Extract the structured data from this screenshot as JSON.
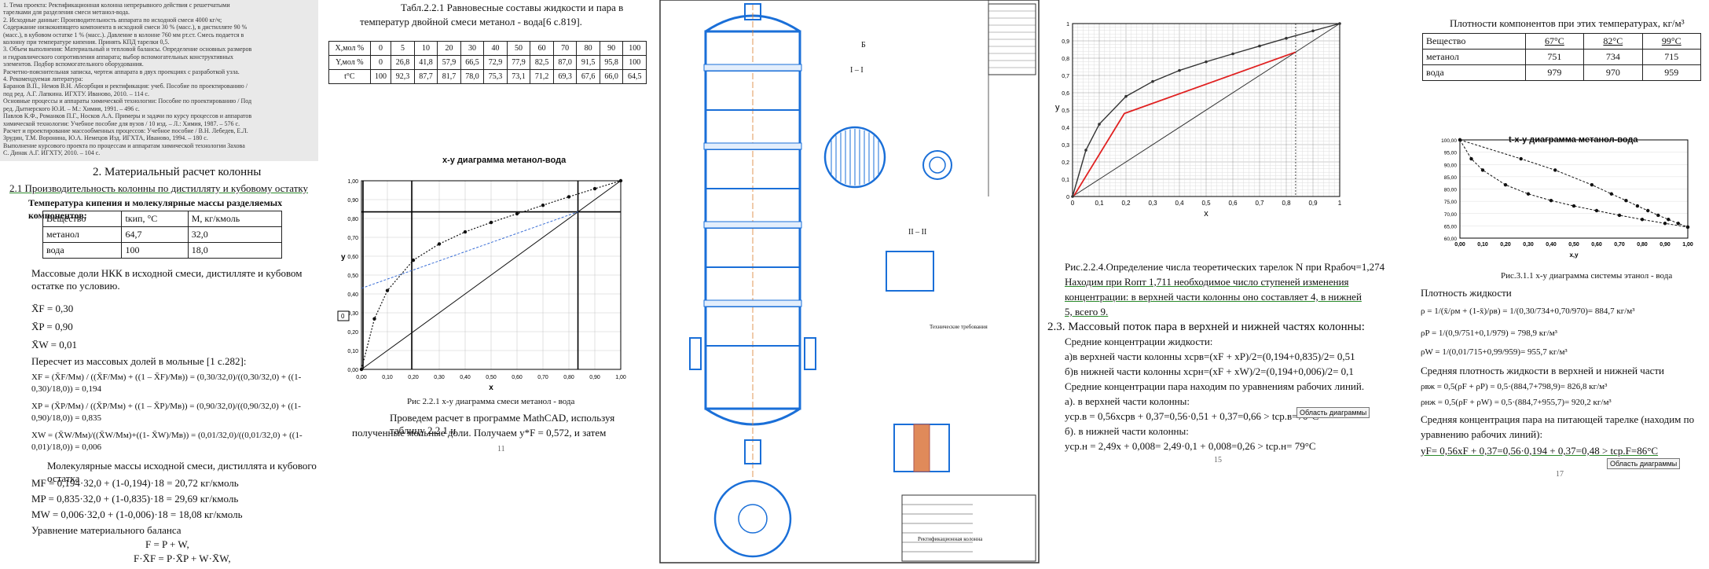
{
  "panel1": {
    "top_lines": [
      "1. Тема проекта: Ректификационная колонна непрерывного действия с решетчатыми",
      "тарелками для разделения смеси метанол-вода.",
      "2. Исходные данные: Производительность аппарата по исходной смеси 4000 кг/ч;",
      "Содержание низкокипящего компонента в исходной смеси 30 % (масс.), в дистилляте 90 %",
      "(масс.), в кубовом остатке 1 % (масс.). Давление в колонне 760 мм рт.ст. Смесь подается в",
      "колонну при температуре кипения. Принять КПД тарелки 0,5.",
      "3. Объем выполнения: Материальный и тепловой балансы. Определение основных размеров",
      "и гидравлического сопротивления аппарата; выбор вспомогательных конструктивных",
      "элементов. Подбор вспомогательного оборудования.",
      "Расчетно-пояснительная записка, чертеж аппарата в двух проекциях с разработкой узла.",
      "4. Рекомендуемая литература:",
      "Баранов В.П., Немов В.Н. Абсорбция и ректификация: учеб. Пособие по проектированию /",
      "под ред. А.Г. Лапкина. ИГХТУ. Иваново, 2010. – 114 с.",
      "Основные процессы и аппараты химической технологии: Пособие по проектированию / Под",
      "ред. Дытнерского Ю.И. – М.: Химия, 1991. – 496 с.",
      "Павлов К.Ф., Романков П.Г., Носков А.А. Примеры и задачи по курсу процессов и аппаратов",
      "химической технологии: Учебное пособие для вузов / 10 изд. – Л.: Химия, 1987. – 576 с.",
      "Расчет и проектирование массообменных процессов: Учебное пособие / В.Н. Лебедев, Е.Л.",
      "Зрудин, Т.М. Воронина, Ю.А. Немецов Изд. ИГХТА, Иваново, 1994. – 180 с.",
      "Выполнение курсового проекта по процессам и аппаратам химической технологии Захова",
      "С. Динак А.Г. ИГХТУ, 2010. – 104 с."
    ],
    "section_title": "2. Материальный расчет колонны",
    "subsection": "2.1 Производительность колонны по дистилляту и кубовому остатку",
    "table_caption": "Температура кипения и молекулярные массы разделяемых компонентов:",
    "table_head": [
      "Вещество",
      "tкип, °С",
      "M, кг/кмоль"
    ],
    "table_rows": [
      [
        "метанол",
        "64,7",
        "32,0"
      ],
      [
        "вода",
        "100",
        "18,0"
      ]
    ],
    "text1": "Массовые доли НКК в исходной смеси, дистилляте и кубовом остатке по условию.",
    "xf": "X̄F = 0,30",
    "xp": "X̄P = 0,90",
    "xw": "X̄W = 0,01",
    "recalc": "Пересчет из массовых долей в мольные [1 с.282]:",
    "f1a": "XF = (X̄F/Mм) / ((X̄F/Mм) + ((1 – X̄F)/Mв)) = (0,30/32,0)/((0,30/32,0) + ((1-",
    "f1b": "0,30)/18,0)) = 0,194",
    "f2a": "XP = (X̄P/Mм) / ((X̄P/Mм) + ((1 – X̄P)/Mв)) = (0,90/32,0)/((0,90/32,0) + ((1-",
    "f2b": "0,90)/18,0)) = 0,835",
    "f3a": "XW = (X̄W/Mм)/((X̄W/Mм)+((1- X̄W)/Mв)) = (0,01/32,0)/((0,01/32,0) + ((1-",
    "f3b": "0,01)/18,0)) = 0,006",
    "mol_title": "Молекулярные массы исходной смеси, дистиллята и кубового остатка",
    "mf": "MF = 0,194·32,0 + (1-0,194)·18 = 20,72 кг/кмоль",
    "mp": "MP = 0,835·32,0 + (1-0,835)·18 = 29,69 кг/кмоль",
    "mw": "MW = 0,006·32,0 + (1-0,006)·18 = 18,08 кг/кмоль",
    "balance_title": "Уравнение материального баланса",
    "eq1": "F = P + W,",
    "eq2": "F·X̄F = P·X̄P + W·X̄W,"
  },
  "panel2": {
    "table_title": "Табл.2.2.1 Равновесные составы жидкости и пара в",
    "table_title2": "температур двойной смеси метанол - вода[6 с.819].",
    "row_x": [
      "X,мол %",
      "0",
      "5",
      "10",
      "20",
      "30",
      "40",
      "50",
      "60",
      "70",
      "80",
      "90",
      "100"
    ],
    "row_y": [
      "Y,мол %",
      "0",
      "26,8",
      "41,8",
      "57,9",
      "66,5",
      "72,9",
      "77,9",
      "82,5",
      "87,0",
      "91,5",
      "95,8",
      "100"
    ],
    "row_t": [
      "t°C",
      "100",
      "92,3",
      "87,7",
      "81,7",
      "78,0",
      "75,3",
      "73,1",
      "71,2",
      "69,3",
      "67,6",
      "66,0",
      "64,5"
    ],
    "chart_title": "x-y диаграмма метанол-вода",
    "xlabel": "x",
    "ylabel": "y",
    "tick_x": [
      "0,00",
      "0,10",
      "0,20",
      "0,30",
      "0,40",
      "0,50",
      "0,60",
      "0,70",
      "0,80",
      "0,90",
      "1,00"
    ],
    "tick_y": [
      "0,00",
      "0,10",
      "0,20",
      "0,30",
      "0,40",
      "0,50",
      "0,60",
      "0,70",
      "0,80",
      "0,90",
      "1,00"
    ],
    "box_label": "0",
    "caption": "Рис 2.2.1 x-y диаграмма смеси метанол - вода",
    "text_a": "Проведем расчет в программе MathCAD, используя таблицу 2.2.1 и",
    "text_b": "полученные мольные доли. Получаем y*F = 0,572, и затем",
    "page_no": "11"
  },
  "panel3": {
    "section_labels": [
      "Б",
      "I – I",
      "II – II"
    ],
    "note_title": "Технические требования",
    "stamp_label": "Ректификационная колонна"
  },
  "panel4": {
    "y_label": "y",
    "x_label": "x",
    "tick_x": [
      "0",
      "0,1",
      "0,2",
      "0,3",
      "0,4",
      "0,5",
      "0,6",
      "0,7",
      "0,8",
      "0,9",
      "1"
    ],
    "tick_y": [
      "0",
      "0,1",
      "0,2",
      "0,3",
      "0,4",
      "0,5",
      "0,6",
      "0,7",
      "0,8",
      "0,9",
      "1"
    ],
    "fig_caption_a": "Рис.2.2.4.Определение числа теоретических тарелок N при Rрабоч=1,274",
    "fig_caption_b": "Находим при Rопт 1,711 необходимое число ступеней изменения",
    "fig_caption_c": "концентрации: в верхней части колонны оно составляет 4, в нижней",
    "fig_caption_d": "5, всего 9.",
    "sec_title": "2.3. Массовый поток пара в верхней и нижней частях колонны:",
    "avg_liquid": "Средние концентрации жидкости:",
    "a_top": "а)в верхней части колонны xсрв=(xF + xP)/2=(0,194+0,835)/2= 0,51",
    "b_bottom": "б)в нижней части колонны xсрн=(xF + xW)/2=(0,194+0,006)/2= 0,1",
    "avg_vapor": "Средние концентрации пара находим по уравнениям рабочих линий.",
    "a_vapor": "а). в верхней части колонны:",
    "eq_top": "yср.в = 0,56xсрв + 0,37=0,56·0,51 + 0,37=0,66 > tср.в=70°С",
    "b_vapor": "б). в нижней части колонны:",
    "eq_bot": "yср.н = 2,49x + 0,008= 2,49·0,1 + 0,008=0,26 > tср.н= 79°С",
    "tooltip": "Область диаграммы",
    "page_no": "15"
  },
  "panel5": {
    "density_title": "Плотности компонентов при этих температурах, кг/м³",
    "table_head": [
      "Вещество",
      "67°С",
      "82°С",
      "99°С"
    ],
    "table_rows": [
      [
        "метанол",
        "751",
        "734",
        "715"
      ],
      [
        "вода",
        "979",
        "970",
        "959"
      ]
    ],
    "chart_title": "t-x-y диаграмма метанол-вода",
    "tick_y": [
      "100,00",
      "95,00",
      "90,00",
      "85,00",
      "80,00",
      "75,00",
      "70,00",
      "65,00",
      "60,00"
    ],
    "tick_x": [
      "0,00",
      "0,10",
      "0,20",
      "0,30",
      "0,40",
      "0,50",
      "0,60",
      "0,70",
      "0,80",
      "0,90",
      "1,00"
    ],
    "xlabel": "x,y",
    "caption": "Рис.3.1.1 x-y диаграмма системы этанол - вода",
    "density_label": "Плотность жидкости",
    "rho1": "ρ = 1/(x̄/ρм + (1-x̄)/ρв) = 1/(0,30/734+0,70/970)= 884,7 кг/м³",
    "rho2": "ρP = 1/(0,9/751+0,1/979) = 798,9 кг/м³",
    "rho3": "ρW = 1/(0,01/715+0,99/959)= 955,7 кг/м³",
    "avg_density_title": "Средняя плотность жидкости в верхней и нижней части",
    "rho_top": "ρвж = 0,5(ρF + ρP) = 0,5·(884,7+798,9)= 826,8 кг/м³",
    "rho_bot": "ρнж = 0,5(ρF + ρW) = 0,5·(884,7+955,7)= 920,2 кг/м³",
    "feed_a": "Средняя концентрация пара на питающей тарелке (находим по",
    "feed_b": "уравнению рабочих линий):",
    "feed_eq": "yF= 0,56xF + 0,37=0,56·0,194 + 0,37=0,48 > tср.F=86°С",
    "tooltip": "Область диаграммы",
    "page_no": "17"
  },
  "chart_data": [
    {
      "type": "line",
      "title": "x-y диаграмма метанол-вода",
      "xlabel": "x",
      "ylabel": "y",
      "xlim": [
        0,
        1
      ],
      "ylim": [
        0,
        1
      ],
      "series": [
        {
          "x": [
            0,
            0.05,
            0.1,
            0.2,
            0.3,
            0.4,
            0.5,
            0.6,
            0.7,
            0.8,
            0.9,
            1
          ],
          "y": [
            0,
            0.268,
            0.418,
            0.579,
            0.665,
            0.729,
            0.779,
            0.825,
            0.87,
            0.915,
            0.958,
            1
          ]
        },
        {
          "x": [
            0,
            1
          ],
          "y": [
            0,
            1
          ]
        },
        {
          "x": [
            0,
            0.835
          ],
          "y": [
            0.43,
            0.835
          ]
        }
      ]
    },
    {
      "type": "line",
      "xlabel": "x",
      "ylabel": "y",
      "xlim": [
        0,
        1
      ],
      "ylim": [
        0,
        1
      ],
      "series": [
        {
          "x": [
            0,
            0.05,
            0.1,
            0.2,
            0.3,
            0.4,
            0.5,
            0.6,
            0.7,
            0.8,
            0.9,
            1
          ],
          "y": [
            0,
            0.268,
            0.418,
            0.579,
            0.665,
            0.729,
            0.779,
            0.825,
            0.87,
            0.915,
            0.958,
            1
          ]
        },
        {
          "x": [
            0,
            1
          ],
          "y": [
            0,
            1
          ]
        },
        {
          "x": [
            0.006,
            0.194,
            0.835
          ],
          "y": [
            0.006,
            0.48,
            0.835
          ]
        }
      ]
    },
    {
      "type": "line",
      "title": "t-x-y диаграмма метанол-вода",
      "xlabel": "x,y",
      "xlim": [
        0,
        1
      ],
      "ylim": [
        60,
        100
      ],
      "series": [
        {
          "x": [
            0,
            0.05,
            0.1,
            0.2,
            0.3,
            0.4,
            0.5,
            0.6,
            0.7,
            0.8,
            0.9,
            1
          ],
          "y": [
            100,
            92.3,
            87.7,
            81.7,
            78.0,
            75.3,
            73.1,
            71.2,
            69.3,
            67.6,
            66.0,
            64.5
          ]
        },
        {
          "x": [
            0,
            0.268,
            0.418,
            0.579,
            0.665,
            0.729,
            0.779,
            0.825,
            0.87,
            0.915,
            0.958,
            1
          ],
          "y": [
            100,
            92.3,
            87.7,
            81.7,
            78.0,
            75.3,
            73.1,
            71.2,
            69.3,
            67.6,
            66.0,
            64.5
          ]
        }
      ]
    }
  ]
}
